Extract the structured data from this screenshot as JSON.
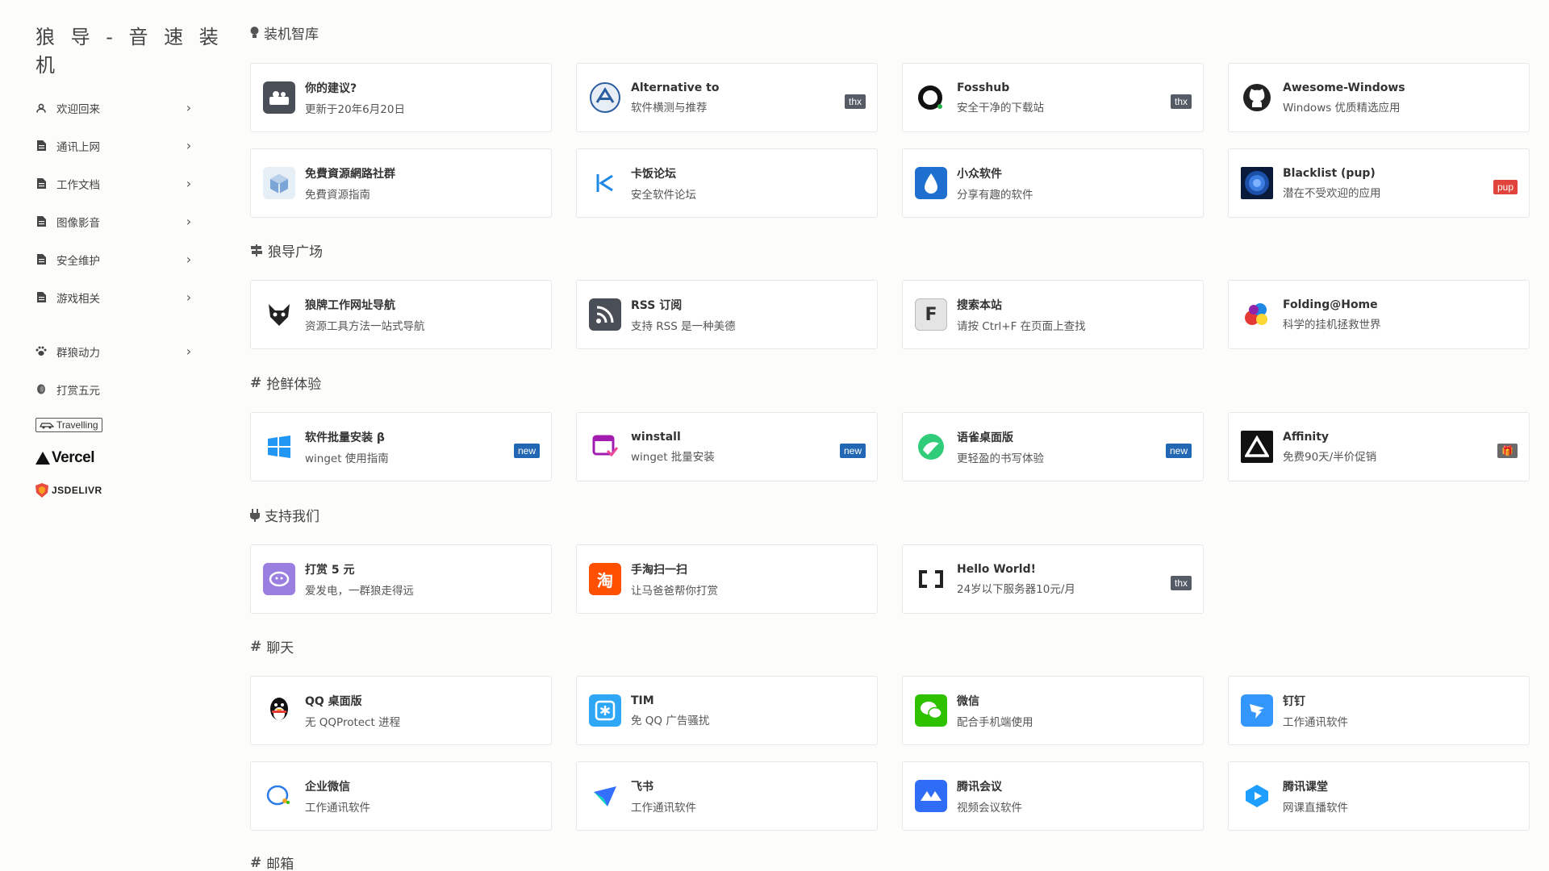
{
  "logo": "狼 导 - 音 速 装 机",
  "sidebar": {
    "items": [
      {
        "label": "欢迎回来",
        "icon": "user-icon"
      },
      {
        "label": "通讯上网",
        "icon": "doc-icon"
      },
      {
        "label": "工作文档",
        "icon": "doc-icon"
      },
      {
        "label": "图像影音",
        "icon": "doc-icon"
      },
      {
        "label": "安全维护",
        "icon": "doc-icon"
      },
      {
        "label": "游戏相关",
        "icon": "doc-icon"
      }
    ],
    "extra": [
      {
        "label": "群狼动力",
        "icon": "paw-icon"
      },
      {
        "label": "打赏五元",
        "icon": "coin-icon"
      }
    ],
    "travelling": "Travelling",
    "vercel": "Vercel",
    "jsdelivr": "JSDELIVR"
  },
  "sections": {
    "s1": "装机智库",
    "s2": "狼导广场",
    "s3": "抢鲜体验",
    "s4": "支持我们",
    "s5": "聊天",
    "s6": "邮箱"
  },
  "cards": {
    "c1": {
      "name": "你的建议?",
      "desc": "更新于20年6月20日",
      "tag": "",
      "color": "#4a4f57"
    },
    "c2": {
      "name": "Alternative to",
      "desc": "软件横测与推荐",
      "tag": "thx",
      "color": "#e8eef5"
    },
    "c3": {
      "name": "Fosshub",
      "desc": "安全干净的下载站",
      "tag": "thx",
      "color": "#ffffff"
    },
    "c4": {
      "name": "Awesome-Windows",
      "desc": "Windows 优质精选应用",
      "tag": "",
      "color": "#ffffff"
    },
    "c5": {
      "name": "免費資源網路社群",
      "desc": "免費資源指南",
      "tag": "",
      "color": "#e6eef6"
    },
    "c6": {
      "name": "卡饭论坛",
      "desc": "安全软件论坛",
      "tag": "",
      "color": "#ffffff"
    },
    "c7": {
      "name": "小众软件",
      "desc": "分享有趣的软件",
      "tag": "",
      "color": "#1f6fd1"
    },
    "c8": {
      "name": "Blacklist (pup)",
      "desc": "潜在不受欢迎的应用",
      "tag": "pup",
      "color": "#0a1a3a"
    },
    "c9": {
      "name": "狼牌工作网址导航",
      "desc": "资源工具方法一站式导航",
      "tag": "",
      "color": "#ffffff"
    },
    "c10": {
      "name": "RSS 订阅",
      "desc": "支持 RSS 是一种美德",
      "tag": "",
      "color": "#4a4f57"
    },
    "c11": {
      "name": "搜索本站",
      "desc": "请按 Ctrl+F 在页面上查找",
      "tag": "",
      "color": "#e4e4e4"
    },
    "c12": {
      "name": "Folding@Home",
      "desc": "科学的挂机拯救世界",
      "tag": "",
      "color": "#ffffff"
    },
    "c13": {
      "name": "软件批量安装 β",
      "desc": "winget 使用指南",
      "tag": "new",
      "color": "#ffffff"
    },
    "c14": {
      "name": "winstall",
      "desc": "winget 批量安装",
      "tag": "new",
      "color": "#ffffff"
    },
    "c15": {
      "name": "语雀桌面版",
      "desc": "更轻盈的书写体验",
      "tag": "new",
      "color": "#ffffff"
    },
    "c16": {
      "name": "Affinity",
      "desc": "免费90天/半价促销",
      "tag": "🎁",
      "color": "#111111"
    },
    "c17": {
      "name": "打赏 5 元",
      "desc": "爱发电，一群狼走得远",
      "tag": "",
      "color": "#9a7fe0"
    },
    "c18": {
      "name": "手淘扫一扫",
      "desc": "让马爸爸帮你打赏",
      "tag": "",
      "color": "#ff5000"
    },
    "c19": {
      "name": "Hello World!",
      "desc": "24岁以下服务器10元/月",
      "tag": "thx",
      "color": "#ffffff"
    },
    "c20": {
      "name": "QQ 桌面版",
      "desc": "无 QQProtect 进程",
      "tag": "",
      "color": "#ffffff"
    },
    "c21": {
      "name": "TIM",
      "desc": "免 QQ 广告骚扰",
      "tag": "",
      "color": "#2ea7f7"
    },
    "c22": {
      "name": "微信",
      "desc": "配合手机端使用",
      "tag": "",
      "color": "#2dc100"
    },
    "c23": {
      "name": "钉钉",
      "desc": "工作通讯软件",
      "tag": "",
      "color": "#3296fa"
    },
    "c24": {
      "name": "企业微信",
      "desc": "工作通讯软件",
      "tag": "",
      "color": "#ffffff"
    },
    "c25": {
      "name": "飞书",
      "desc": "工作通讯软件",
      "tag": "",
      "color": "#ffffff"
    },
    "c26": {
      "name": "腾讯会议",
      "desc": "视频会议软件",
      "tag": "",
      "color": "#2f6df6"
    },
    "c27": {
      "name": "腾讯课堂",
      "desc": "网课直播软件",
      "tag": "",
      "color": "#ffffff"
    }
  }
}
